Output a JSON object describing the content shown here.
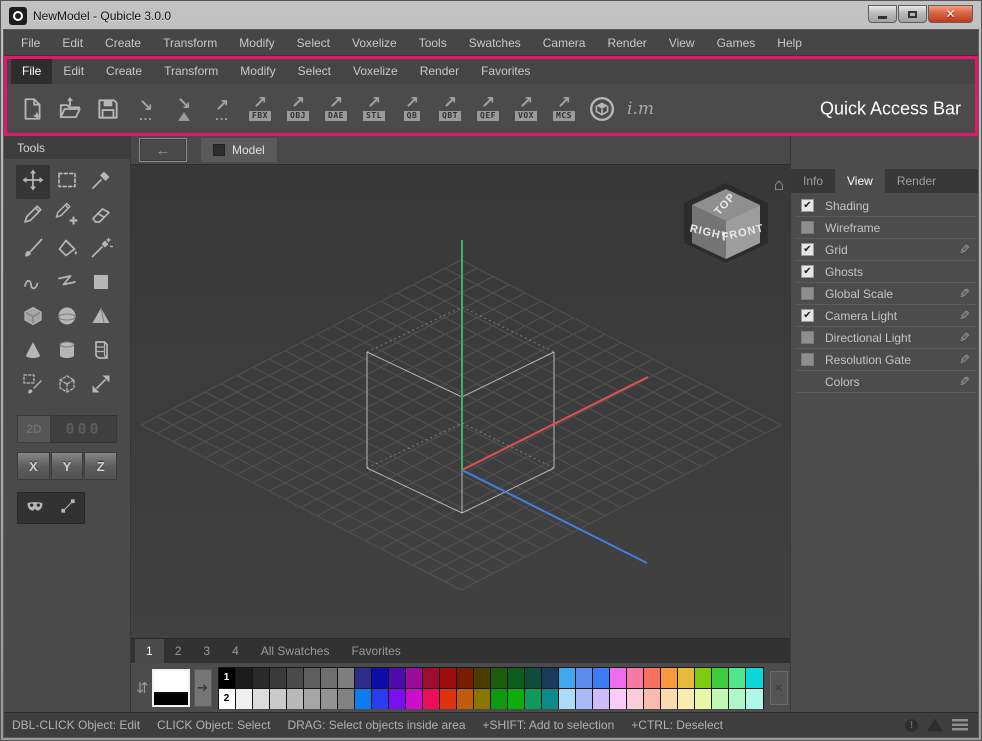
{
  "window": {
    "title": "NewModel - Qubicle 3.0.0",
    "control_icons": [
      "minimize-icon",
      "maximize-icon",
      "close-icon"
    ],
    "close_glyph": "✕"
  },
  "menubar": {
    "items": [
      "File",
      "Edit",
      "Create",
      "Transform",
      "Modify",
      "Select",
      "Voxelize",
      "Tools",
      "Swatches",
      "Camera",
      "Render",
      "View",
      "Games",
      "Help"
    ]
  },
  "quick_access_bar": {
    "label": "Quick Access Bar",
    "accent_color": "#e8156d",
    "menu": {
      "items": [
        "File",
        "Edit",
        "Create",
        "Transform",
        "Modify",
        "Select",
        "Voxelize",
        "Render",
        "Favorites"
      ],
      "active_index": 0
    },
    "buttons": [
      {
        "name": "new-model-button",
        "icon": "new-doc"
      },
      {
        "name": "open-button",
        "icon": "open"
      },
      {
        "name": "save-button",
        "icon": "save"
      },
      {
        "name": "import-button",
        "icon": "arrow-in",
        "sub_dots": "..."
      },
      {
        "name": "import-mesh-button",
        "icon": "arrow-in",
        "sub_tri": true
      },
      {
        "name": "export-button",
        "icon": "arrow-out",
        "sub_dots": "..."
      },
      {
        "name": "export-fbx-button",
        "icon": "arrow-out",
        "label": "FBX"
      },
      {
        "name": "export-obj-button",
        "icon": "arrow-out",
        "label": "OBJ"
      },
      {
        "name": "export-dae-button",
        "icon": "arrow-out",
        "label": "DAE"
      },
      {
        "name": "export-stl-button",
        "icon": "arrow-out",
        "label": "STL"
      },
      {
        "name": "export-qb-button",
        "icon": "arrow-out",
        "label": "QB"
      },
      {
        "name": "export-qbt-button",
        "icon": "arrow-out",
        "label": "QBT"
      },
      {
        "name": "export-qef-button",
        "icon": "arrow-out",
        "label": "QEF"
      },
      {
        "name": "export-vox-button",
        "icon": "arrow-out",
        "label": "VOX"
      },
      {
        "name": "export-mcs-button",
        "icon": "arrow-out",
        "label": "MCS"
      },
      {
        "name": "sketchfab-button",
        "icon": "sketchfab"
      },
      {
        "name": "imaterialise-button",
        "icon": "im-logo",
        "label_text": "i.m"
      }
    ]
  },
  "tools_panel": {
    "title": "Tools",
    "tools": [
      {
        "name": "move-tool",
        "icon": "move",
        "selected": true
      },
      {
        "name": "rect-select-tool",
        "icon": "rect-select"
      },
      {
        "name": "color-picker-tool",
        "icon": "picker"
      },
      {
        "name": "pencil-tool",
        "icon": "pencil"
      },
      {
        "name": "pencil-add-tool",
        "icon": "pencil-add"
      },
      {
        "name": "eraser-tool",
        "icon": "eraser"
      },
      {
        "name": "brush-tool",
        "icon": "brush"
      },
      {
        "name": "fill-tool",
        "icon": "fill"
      },
      {
        "name": "magic-wand-tool",
        "icon": "wand"
      },
      {
        "name": "freehand-tool",
        "icon": "freehand"
      },
      {
        "name": "line-tool",
        "icon": "zigzag"
      },
      {
        "name": "rectangle-tool",
        "icon": "rectangle"
      },
      {
        "name": "box-tool",
        "icon": "box"
      },
      {
        "name": "sphere-tool",
        "icon": "sphere"
      },
      {
        "name": "pyramid-tool",
        "icon": "pyramid"
      },
      {
        "name": "cone-tool",
        "icon": "cone"
      },
      {
        "name": "cylinder-tool",
        "icon": "cylinder"
      },
      {
        "name": "slice-tool",
        "icon": "slice"
      },
      {
        "name": "brush-select-tool",
        "icon": "brush-select"
      },
      {
        "name": "cube-select-tool",
        "icon": "cube-select"
      },
      {
        "name": "resize-tool",
        "icon": "resize"
      }
    ],
    "dimension_toggle": {
      "label_2d": "2D",
      "counter": "000"
    },
    "axis_buttons": [
      "X",
      "Y",
      "Z"
    ],
    "extra_tools": [
      {
        "name": "mask-tool",
        "icon": "mask"
      },
      {
        "name": "spline-tool",
        "icon": "spline"
      }
    ]
  },
  "viewport": {
    "tab_label": "Model",
    "nav_cube": {
      "top": "TOP",
      "left": "RIGHT",
      "right": "FRONT"
    },
    "axis_colors": {
      "x": "#e05252",
      "y": "#3bb45a",
      "z": "#4080d8"
    },
    "grid_color": "#515151",
    "cube_color": "#cccccc",
    "background": "#3e3e3e"
  },
  "right_panel": {
    "tabs": [
      "Info",
      "View",
      "Render"
    ],
    "active_tab": "View",
    "items": [
      {
        "label": "Shading",
        "checked": true,
        "editable": false
      },
      {
        "label": "Wireframe",
        "checked": false,
        "editable": false
      },
      {
        "label": "Grid",
        "checked": true,
        "editable": true
      },
      {
        "label": "Ghosts",
        "checked": true,
        "editable": false
      },
      {
        "label": "Global Scale",
        "checked": false,
        "editable": true
      },
      {
        "label": "Camera Light",
        "checked": true,
        "editable": true
      },
      {
        "label": "Directional Light",
        "checked": false,
        "editable": true
      },
      {
        "label": "Resolution Gate",
        "checked": false,
        "editable": true
      },
      {
        "label": "Colors",
        "checked": null,
        "editable": true
      }
    ],
    "check_glyph": "✔"
  },
  "swatches": {
    "tabs": [
      "1",
      "2",
      "3",
      "4",
      "All Swatches",
      "Favorites"
    ],
    "active_tab": "1",
    "row1_label": "1",
    "row2_label": "2",
    "primary_color": "#ffffff",
    "secondary_color": "#000000",
    "palette_row1": [
      "#000000",
      "#1c1c1c",
      "#2b2b2b",
      "#3a3a3a",
      "#4a4a4a",
      "#5d5d5d",
      "#6e6e6e",
      "#7f7f7f",
      "#2e2e8a",
      "#0d0daa",
      "#4d0dad",
      "#9a0d9a",
      "#9c0d2e",
      "#9c0d0d",
      "#7a1c00",
      "#4d3c00",
      "#1f5c0d",
      "#0d5c1c",
      "#0d4d3c",
      "#1c3a5c",
      "#3fa8ee",
      "#5c8cee",
      "#3c7cf5",
      "#ee6cee",
      "#f87aa0",
      "#f8705e",
      "#f89a3c",
      "#e8ba3c",
      "#7ecc0d",
      "#3ecc3e",
      "#4ee88a",
      "#0dd8d8"
    ],
    "palette_row2": [
      "#ffffff",
      "#efefef",
      "#dcdcdc",
      "#cacaca",
      "#b8b8b8",
      "#a5a5a5",
      "#939393",
      "#828282",
      "#0d7cee",
      "#2a3cee",
      "#7c0dee",
      "#cc0dcc",
      "#ee0d5c",
      "#dd330d",
      "#c25c0d",
      "#8a7500",
      "#0d9a0d",
      "#0dad0d",
      "#0d9a5c",
      "#0d8a8a",
      "#aadcf8",
      "#aab8f8",
      "#ccbcf8",
      "#f8ccf8",
      "#f8ccd8",
      "#f8bcae",
      "#f8dcae",
      "#f8ecae",
      "#e4f8a6",
      "#c2f8b4",
      "#aef8c8",
      "#aef8e8"
    ]
  },
  "status_bar": {
    "hints": [
      "DBL-CLICK Object: Edit",
      "CLICK Object: Select",
      "DRAG: Select objects inside area",
      "+SHIFT: Add to selection",
      "+CTRL: Deselect"
    ],
    "icons": [
      "info-icon",
      "warning-icon",
      "menu-icon"
    ]
  }
}
